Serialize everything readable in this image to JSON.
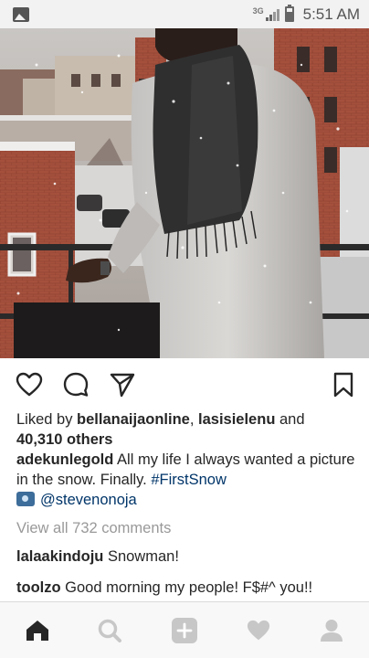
{
  "status_bar": {
    "image_icon": "image-icon",
    "network_type": "3G",
    "time": "5:51 AM"
  },
  "post": {
    "likes": {
      "prefix": "Liked by ",
      "user1": "bellanaijaonline",
      "separator": ", ",
      "user2": "lasisielenu",
      "conjunction": " and",
      "others": "40,310 others"
    },
    "caption": {
      "username": "adekunlegold",
      "text": "All my life I always wanted a picture in the snow. Finally.",
      "hashtag": "#FirstSnow",
      "mention": "@stevenonoja"
    },
    "view_all_comments": "View all 732 comments",
    "comments": [
      {
        "username": "lalaakindoju",
        "text": "Snowman!"
      },
      {
        "username": "toolzo",
        "text": "Good morning my people! F$#^ you!!"
      }
    ]
  },
  "actions": [
    "heart-icon",
    "comment-icon",
    "share-icon",
    "bookmark-icon"
  ],
  "bottom_nav": [
    "home-icon",
    "search-icon",
    "add-post-icon",
    "activity-heart-icon",
    "profile-icon"
  ],
  "colors": {
    "link": "#003569",
    "muted": "#999999",
    "text": "#262626",
    "nav_active": "#262626",
    "nav_inactive": "#c7c7c7"
  }
}
